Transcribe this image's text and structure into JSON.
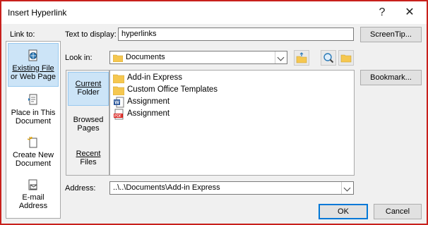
{
  "window": {
    "title": "Insert Hyperlink",
    "help": "?",
    "close": "✕"
  },
  "link_to": {
    "label": "Link to:",
    "items": [
      {
        "line1": "Existing File",
        "line2": "or Web Page",
        "selected": true
      },
      {
        "line1": "Place in This",
        "line2": "Document"
      },
      {
        "line1": "Create New",
        "line2": "Document"
      },
      {
        "line1": "E-mail",
        "line2": "Address"
      }
    ]
  },
  "text_to_display": {
    "label": "Text to display:",
    "value": "hyperlinks"
  },
  "look_in": {
    "label": "Look in:",
    "value": "Documents"
  },
  "nav": {
    "items": [
      {
        "line1": "Current",
        "line2": "Folder",
        "selected": true
      },
      {
        "line1": "Browsed",
        "line2": "Pages"
      },
      {
        "line1": "Recent",
        "line2": "Files"
      }
    ]
  },
  "files": [
    {
      "name": "Add-in Express",
      "icon": "folder-icon"
    },
    {
      "name": "Custom Office Templates",
      "icon": "folder-icon"
    },
    {
      "name": "Assignment",
      "icon": "word-doc-icon"
    },
    {
      "name": "Assignment",
      "icon": "pdf-icon"
    }
  ],
  "address": {
    "label": "Address:",
    "value": "..\\..\\Documents\\Add-in Express"
  },
  "buttons": {
    "screentip": "ScreenTip...",
    "bookmark": "Bookmark...",
    "ok": "OK",
    "cancel": "Cancel"
  },
  "colors": {
    "selection_bg": "#cce4f7",
    "border_accent": "#c8201c",
    "default_button": "#0078d7"
  }
}
